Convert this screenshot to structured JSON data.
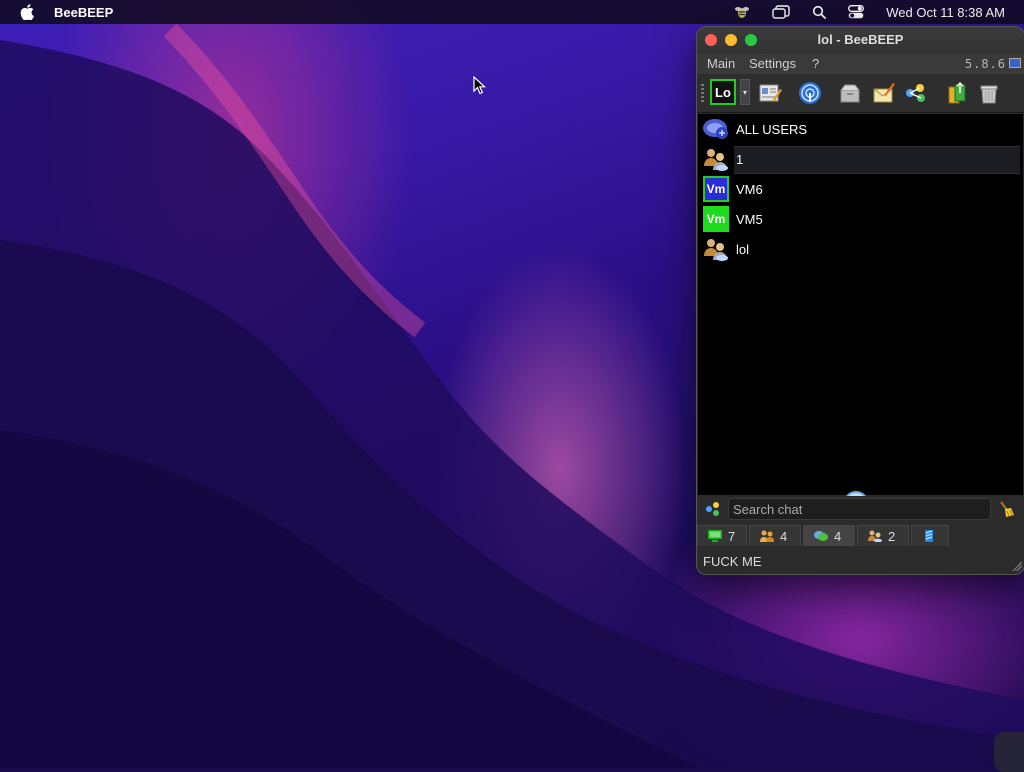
{
  "menubar": {
    "app_name": "BeeBEEP",
    "clock": "Wed Oct 11  8:38 AM",
    "icons": [
      "apple-icon",
      "beebeep-tray-icon",
      "window-switch-icon",
      "spotlight-search-icon",
      "control-center-icon"
    ]
  },
  "window": {
    "title": "lol - BeeBEEP",
    "menus": [
      "Main",
      "Settings",
      "?"
    ],
    "version": "5.8.6",
    "toolbar": {
      "profile_label": "Lo",
      "icons": [
        "profile-status-icon",
        "edit-profile-icon",
        "network-broadcast-icon",
        "file-share-icon",
        "write-message-icon",
        "plugins-icon",
        "update-icon",
        "trash-icon"
      ]
    },
    "users": [
      {
        "name": "ALL USERS",
        "icon": "all-users-icon"
      },
      {
        "name": "1",
        "icon": "group-icon",
        "selected": true
      },
      {
        "name": "VM6",
        "icon": "avatar",
        "initials": "Vm"
      },
      {
        "name": "VM5",
        "icon": "avatar",
        "initials": "Vm"
      },
      {
        "name": "lol",
        "icon": "group-icon"
      }
    ],
    "search": {
      "placeholder": "Search chat"
    },
    "tabs": [
      {
        "icon": "computer-icon",
        "count": "7"
      },
      {
        "icon": "users-icon",
        "count": "4"
      },
      {
        "icon": "chats-icon",
        "count": "4"
      },
      {
        "icon": "groups-icon",
        "count": "2"
      },
      {
        "icon": "log-icon",
        "count": ""
      }
    ],
    "status_text": "FUCK ME"
  },
  "colors": {
    "accent_green": "#22cc22",
    "vm6_avatar": "#2b2bd8",
    "vm5_avatar": "#1edb1e",
    "window_bg": "#2b2b2b",
    "list_bg": "#000000"
  }
}
